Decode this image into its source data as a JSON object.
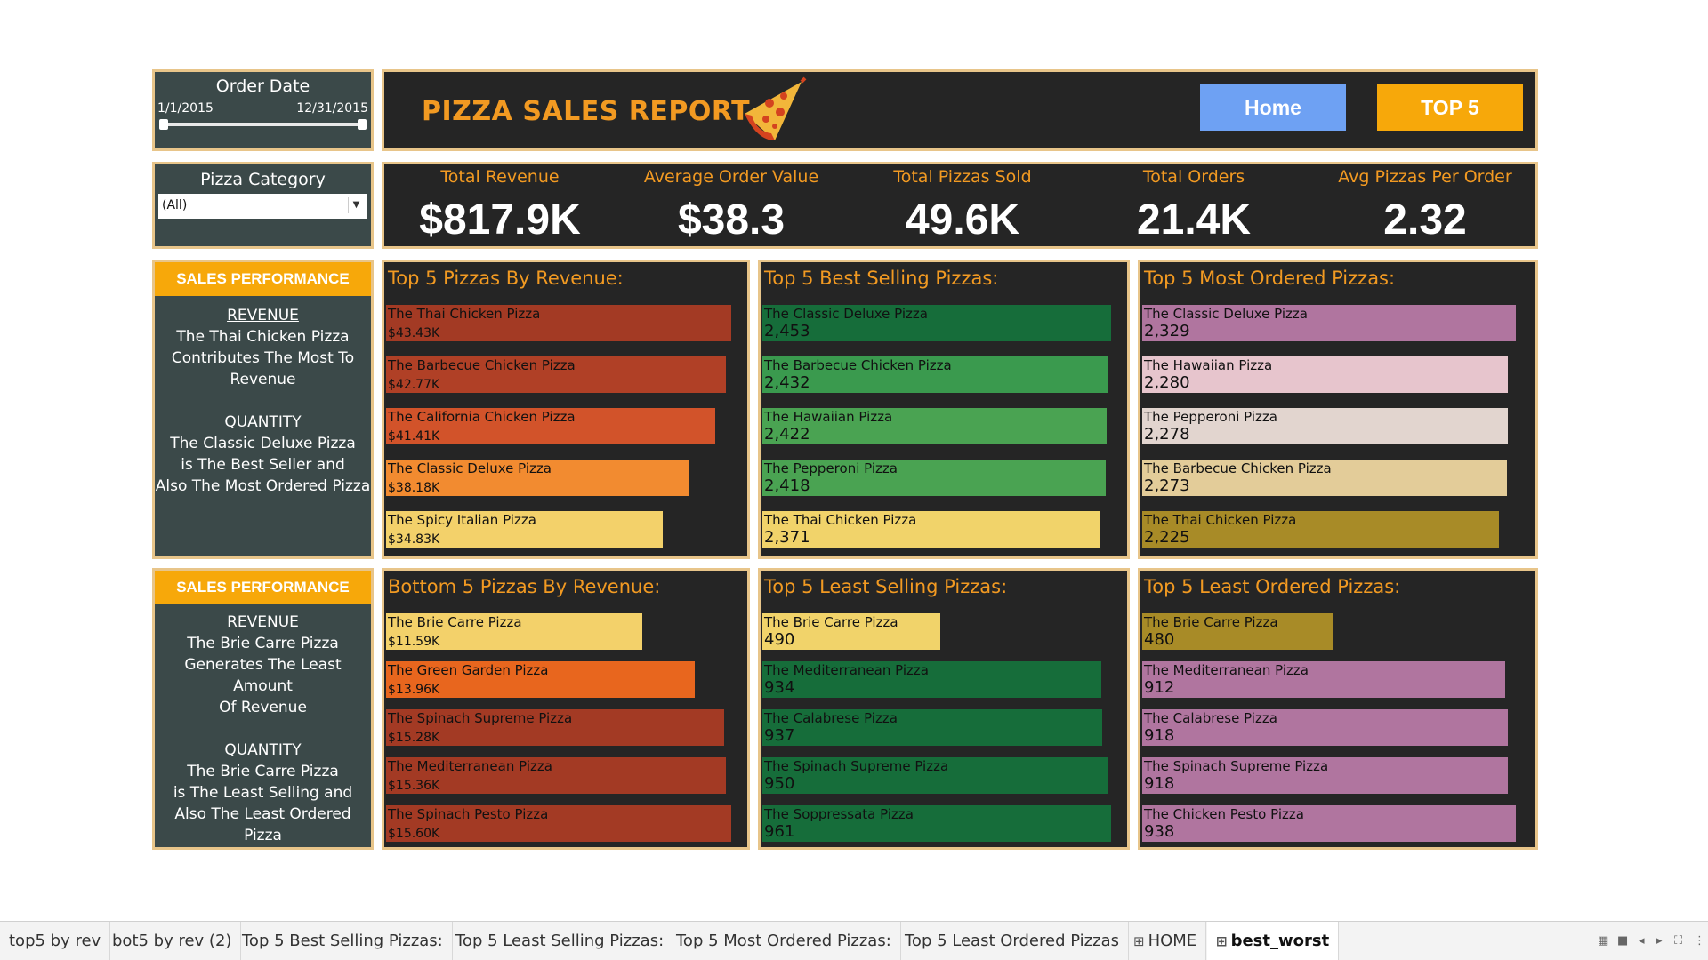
{
  "colors": {
    "panel_bg": "#252525",
    "side_bg": "#3b4949",
    "border": "#e8c58a",
    "accent_orange": "#f29a22",
    "home_button": "#6ea1f3",
    "top5_button": "#f7a80a"
  },
  "filters": {
    "order_date": {
      "title": "Order Date",
      "start": "1/1/2015",
      "end": "12/31/2015"
    },
    "pizza_category": {
      "title": "Pizza Category",
      "selected": "(All)"
    }
  },
  "header": {
    "title": "PIZZA SALES REPORT",
    "logo_icon": "pizza-slice-icon",
    "home_label": "Home",
    "top5_label": "TOP 5"
  },
  "kpis": [
    {
      "label": "Total Revenue",
      "value": "$817.9K"
    },
    {
      "label": "Average Order Value",
      "value": "$38.3"
    },
    {
      "label": "Total Pizzas Sold",
      "value": "49.6K"
    },
    {
      "label": "Total Orders",
      "value": "21.4K"
    },
    {
      "label": "Avg Pizzas Per Order",
      "value": "2.32"
    }
  ],
  "performance_top": {
    "header": "SALES PERFORMANCE",
    "rev_label": "REVENUE",
    "rev_l1": "The Thai Chicken Pizza",
    "rev_l2": "Contributes The Most To",
    "rev_l3": "Revenue",
    "qty_label": "QUANTITY",
    "qty_l1": "The Classic Deluxe Pizza",
    "qty_l2": "is The Best Seller and",
    "qty_l3": "Also The Most Ordered Pizza"
  },
  "performance_bottom": {
    "header": "SALES PERFORMANCE",
    "rev_label": "REVENUE",
    "rev_l1": "The Brie Carre Pizza",
    "rev_l2": "Generates The Least Amount",
    "rev_l3": "Of Revenue",
    "qty_label": "QUANTITY",
    "qty_l1": "The Brie Carre Pizza",
    "qty_l2": "is The Least Selling and",
    "qty_l3": "Also The Least Ordered Pizza"
  },
  "chart_data": [
    {
      "type": "bar",
      "title": "Top 5 Pizzas By Revenue:",
      "metric": "revenue",
      "categories": [
        "The Thai Chicken Pizza",
        "The Barbecue Chicken Pizza",
        "The California Chicken Pizza",
        "The Classic Deluxe Pizza",
        "The Spicy Italian Pizza"
      ],
      "values": [
        43434,
        42768,
        41410,
        38180,
        34831
      ],
      "labels": [
        "$43.43K",
        "$42.77K",
        "$41.41K",
        "$38.18K",
        "$34.83K"
      ],
      "colors": [
        "#a33a24",
        "#b04026",
        "#d2532a",
        "#f28b30",
        "#f3d16a"
      ]
    },
    {
      "type": "bar",
      "title": "Top 5 Best Selling Pizzas:",
      "metric": "quantity",
      "categories": [
        "The Classic Deluxe Pizza",
        "The Barbecue Chicken Pizza",
        "The Hawaiian Pizza",
        "The Pepperoni Pizza",
        "The Thai Chicken Pizza"
      ],
      "values": [
        2453,
        2432,
        2422,
        2418,
        2371
      ],
      "labels": [
        "2,453",
        "2,432",
        "2,422",
        "2,418",
        "2,371"
      ],
      "colors": [
        "#166d3a",
        "#3a9a4e",
        "#4aa352",
        "#4aa352",
        "#f1d36a"
      ]
    },
    {
      "type": "bar",
      "title": "Top 5 Most Ordered Pizzas:",
      "metric": "orders",
      "categories": [
        "The Classic Deluxe Pizza",
        "The Hawaiian Pizza",
        "The Pepperoni Pizza",
        "The Barbecue Chicken Pizza",
        "The Thai Chicken Pizza"
      ],
      "values": [
        2329,
        2280,
        2278,
        2273,
        2225
      ],
      "labels": [
        "2,329",
        "2,280",
        "2,278",
        "2,273",
        "2,225"
      ],
      "colors": [
        "#b0759f",
        "#e7c5cd",
        "#e2d5cf",
        "#e3cc99",
        "#a88b27"
      ]
    },
    {
      "type": "bar",
      "title": "Bottom 5 Pizzas By Revenue:",
      "metric": "revenue",
      "categories": [
        "The Brie Carre Pizza",
        "The Green Garden Pizza",
        "The Spinach Supreme Pizza",
        "The Mediterranean Pizza",
        "The Spinach Pesto Pizza"
      ],
      "values": [
        11588,
        13956,
        15278,
        15360,
        15596
      ],
      "labels": [
        "$11.59K",
        "$13.96K",
        "$15.28K",
        "$15.36K",
        "$15.60K"
      ],
      "colors": [
        "#f3d16a",
        "#e8661e",
        "#a33a24",
        "#a33a24",
        "#a33a24"
      ]
    },
    {
      "type": "bar",
      "title": "Top 5 Least Selling Pizzas:",
      "metric": "quantity",
      "categories": [
        "The Brie Carre Pizza",
        "The Mediterranean Pizza",
        "The Calabrese Pizza",
        "The Spinach Supreme Pizza",
        "The Soppressata Pizza"
      ],
      "values": [
        490,
        934,
        937,
        950,
        961
      ],
      "labels": [
        "490",
        "934",
        "937",
        "950",
        "961"
      ],
      "colors": [
        "#f1d36a",
        "#166d3a",
        "#166d3a",
        "#166d3a",
        "#166d3a"
      ]
    },
    {
      "type": "bar",
      "title": "Top 5 Least Ordered Pizzas:",
      "metric": "orders",
      "categories": [
        "The Brie Carre Pizza",
        "The Mediterranean Pizza",
        "The Calabrese Pizza",
        "The Spinach Supreme Pizza",
        "The Chicken Pesto Pizza"
      ],
      "values": [
        480,
        912,
        918,
        918,
        938
      ],
      "labels": [
        "480",
        "912",
        "918",
        "918",
        "938"
      ],
      "colors": [
        "#a88b27",
        "#b0759f",
        "#b0759f",
        "#b0759f",
        "#b0759f"
      ]
    }
  ],
  "tabs": [
    {
      "label": "top5 by rev"
    },
    {
      "label": "bot5 by rev (2)"
    },
    {
      "label": "Top 5 Best Selling Pizzas:"
    },
    {
      "label": "Top 5 Least Selling Pizzas:"
    },
    {
      "label": "Top 5 Most Ordered Pizzas:"
    },
    {
      "label": "Top 5 Least Ordered Pizzas"
    },
    {
      "label": "HOME",
      "icon": "dashboard-grid-icon"
    },
    {
      "label": "best_worst",
      "icon": "dashboard-grid-icon",
      "active": true
    }
  ],
  "statusbar_icons": [
    "grid-view-icon",
    "single-sheet-icon",
    "previous-sheet-icon",
    "next-sheet-icon",
    "fullscreen-icon",
    "more-icon"
  ]
}
